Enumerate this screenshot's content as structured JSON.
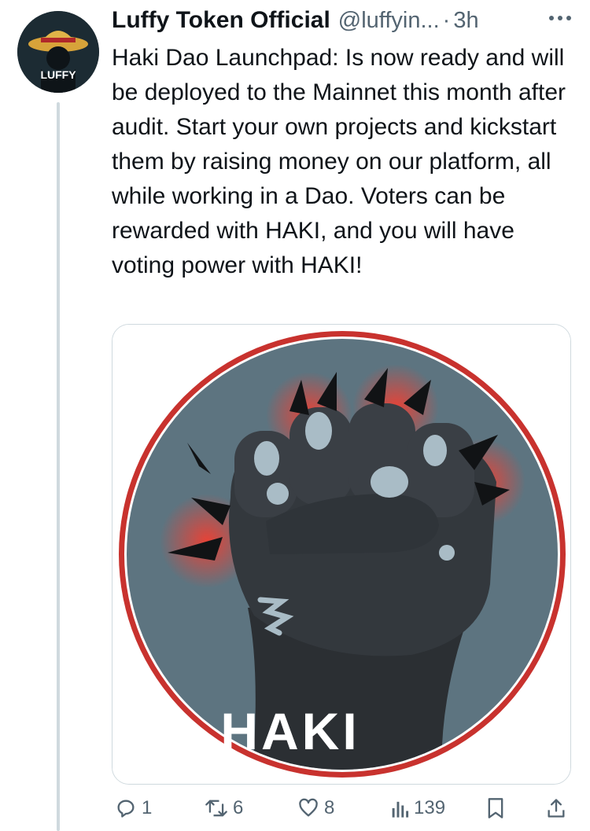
{
  "tweet": {
    "author_name": "Luffy Token Official",
    "handle": "@luffyin...",
    "separator": "·",
    "time": "3h",
    "avatar_text": "LUFFY",
    "text": "Haki Dao Launchpad: Is now ready and will be deployed to the Mainnet this month after audit.  Start your own projects and kickstart them by raising money on our platform, all while working in a Dao. Voters can be rewarded with HAKI, and you will have voting power with HAKI!",
    "image": {
      "label": "HAKI",
      "icon": "haki-fist-icon"
    },
    "actions": {
      "replies": "1",
      "retweets": "6",
      "likes": "8",
      "views": "139"
    }
  },
  "colors": {
    "secondary_text": "#536471",
    "ring_red": "#c8322e",
    "disc_gray": "#5d7480",
    "fist_dark": "#2b2f33"
  }
}
